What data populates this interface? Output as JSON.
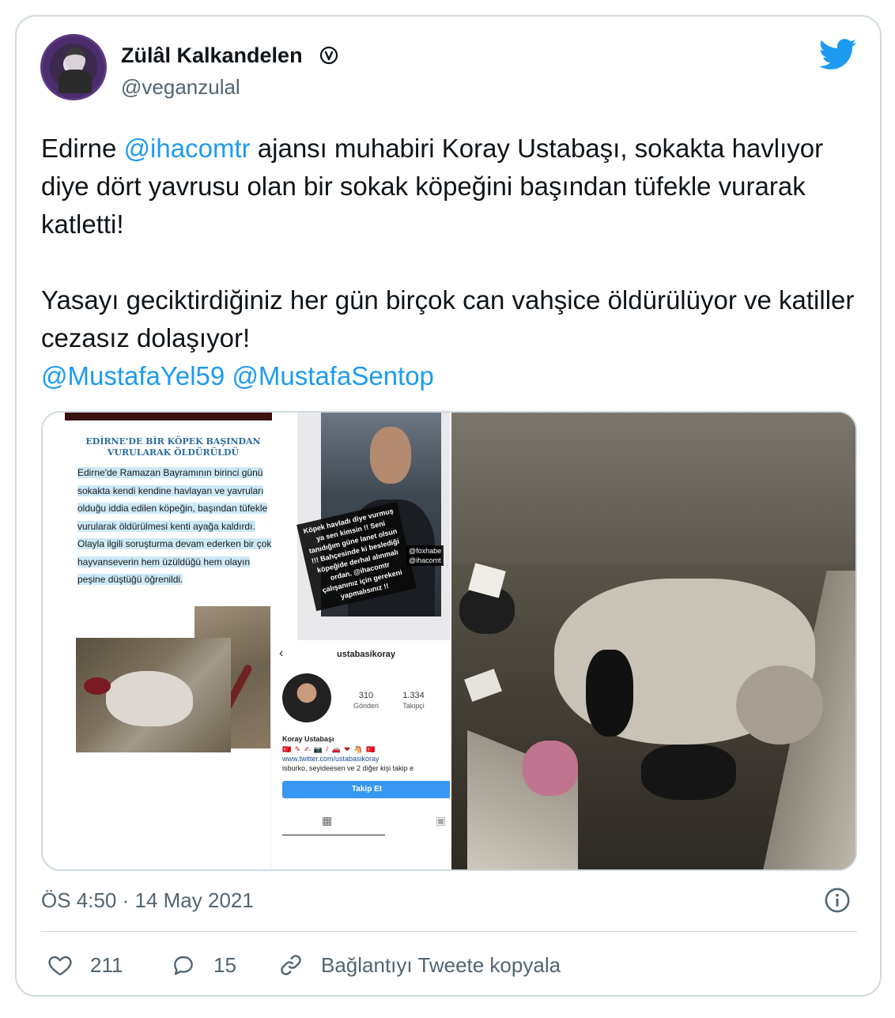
{
  "author": {
    "name": "Zülâl Kalkandelen",
    "handle": "@veganzulal"
  },
  "tweet": {
    "line1_pre": "Edirne ",
    "mention1": "@ihacomtr",
    "line1_post": " ajansı muhabiri Koray Ustabaşı, sokakta havlıyor diye dört yavrusu olan bir sokak köpeğini başından tüfekle vurarak katletti!",
    "para2": "Yasayı geciktirdiğiniz her gün birçok can vahşice öldürülüyor ve katiller cezasız dolaşıyor!",
    "mention2": "@MustafaYel59",
    "mention3": "@MustafaSentop"
  },
  "media": {
    "news_title": "EDİRNE'DE BİR KÖPEK BAŞINDAN VURULARAK ÖLDÜRÜLDÜ",
    "news_body": "Edirne'de Ramazan Bayramının birinci günü sokakta kendi kendine havlayan ve yavruları olduğu iddia edilen köpeğin, başından tüfekle vurularak öldürülmesi kenti ayağa kaldırdı. Olayla ilgili soruşturma devam ederken bir çok hayvanseverin hem üzüldüğü hem olayın peşine düştüğü öğrenildi.",
    "story_quote": "Köpek havladı diye vurmuş ya sen kimsin !! Seni tanıdığım güne lanet olsun !!! Bahçesinde ki beslediği köpeğide derhal alınmalı ordan. @ihacomtr çalışanınız için gerekeni yapmalısınız !!",
    "story_tags": "@foxhabe\n@ihacomt",
    "ig_username": "ustabasikoray",
    "ig_posts_count": "310",
    "ig_posts_label": "Gönderi",
    "ig_followers_count": "1.334",
    "ig_followers_label": "Takipçi",
    "ig_fullname": "Koray Ustabaşı",
    "ig_emoji_line": "🇹🇷 ✎ ✍ 📷 / 🚗 ❤ 🐴 🇹🇷",
    "ig_link": "www.twitter.com/ustabasikoray",
    "ig_followed_by": "isburko, seyideesen ve 2 diğer kişi takip e",
    "ig_follow_button": "Takip Et"
  },
  "timestamp": "ÖS 4:50 · 14 May 2021",
  "actions": {
    "likes": "211",
    "replies": "15",
    "copy_link": "Bağlantıyı Tweete kopyala"
  },
  "colors": {
    "link": "#1d9bf0",
    "secondary_text": "#536471",
    "border": "#cfd9de"
  }
}
